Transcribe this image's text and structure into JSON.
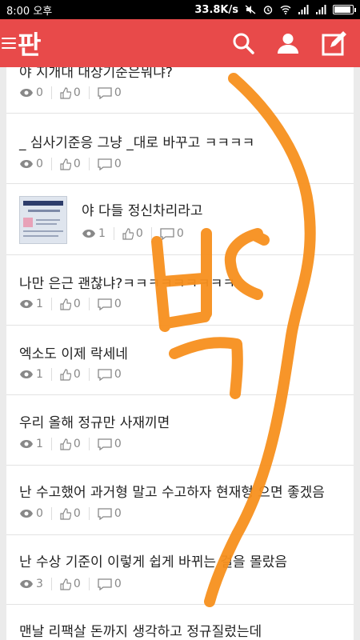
{
  "status_bar": {
    "time": "8:00 오후",
    "speed": "33.8K/s"
  },
  "app": {
    "logo": "판",
    "icons": [
      "menu-icon",
      "search-icon",
      "profile-icon",
      "write-icon"
    ]
  },
  "posts": [
    {
      "title": "야 지개대 대상기준은뭐냐?",
      "views": "0",
      "likes": "0",
      "comments": "0"
    },
    {
      "title": "_ 심사기준응 그냥 _대로 바꾸고 ㅋㅋㅋㅋ",
      "views": "0",
      "likes": "0",
      "comments": "0"
    },
    {
      "title": "야 다들 정신차리라고",
      "views": "1",
      "likes": "0",
      "comments": "0",
      "has_thumbnail": true
    },
    {
      "title": "나만 은근 괜찮냐?ㅋㅋㅋㅋㅋㅋㅋㅋㅋ",
      "views": "1",
      "likes": "0",
      "comments": "0"
    },
    {
      "title": "엑소도 이제 락세네",
      "views": "1",
      "likes": "0",
      "comments": "0"
    },
    {
      "title": "우리 올해 정규만 사재끼면",
      "views": "1",
      "likes": "0",
      "comments": "0"
    },
    {
      "title": "난 수고했어 과거형 말고 수고하자 현재형 으면 좋겠음",
      "views": "0",
      "likes": "0",
      "comments": "0"
    },
    {
      "title": "난 수상 기준이 이렇게 쉽게 바뀌는 걸을 몰랐음",
      "views": "3",
      "likes": "0",
      "comments": "0"
    },
    {
      "title": "맨날 리팩살 돈까지 생각하고 정규질렀는데",
      "views": "",
      "likes": "",
      "comments": ""
    }
  ],
  "colors": {
    "header": "#e84a4a",
    "scribble": "#f7901e"
  }
}
